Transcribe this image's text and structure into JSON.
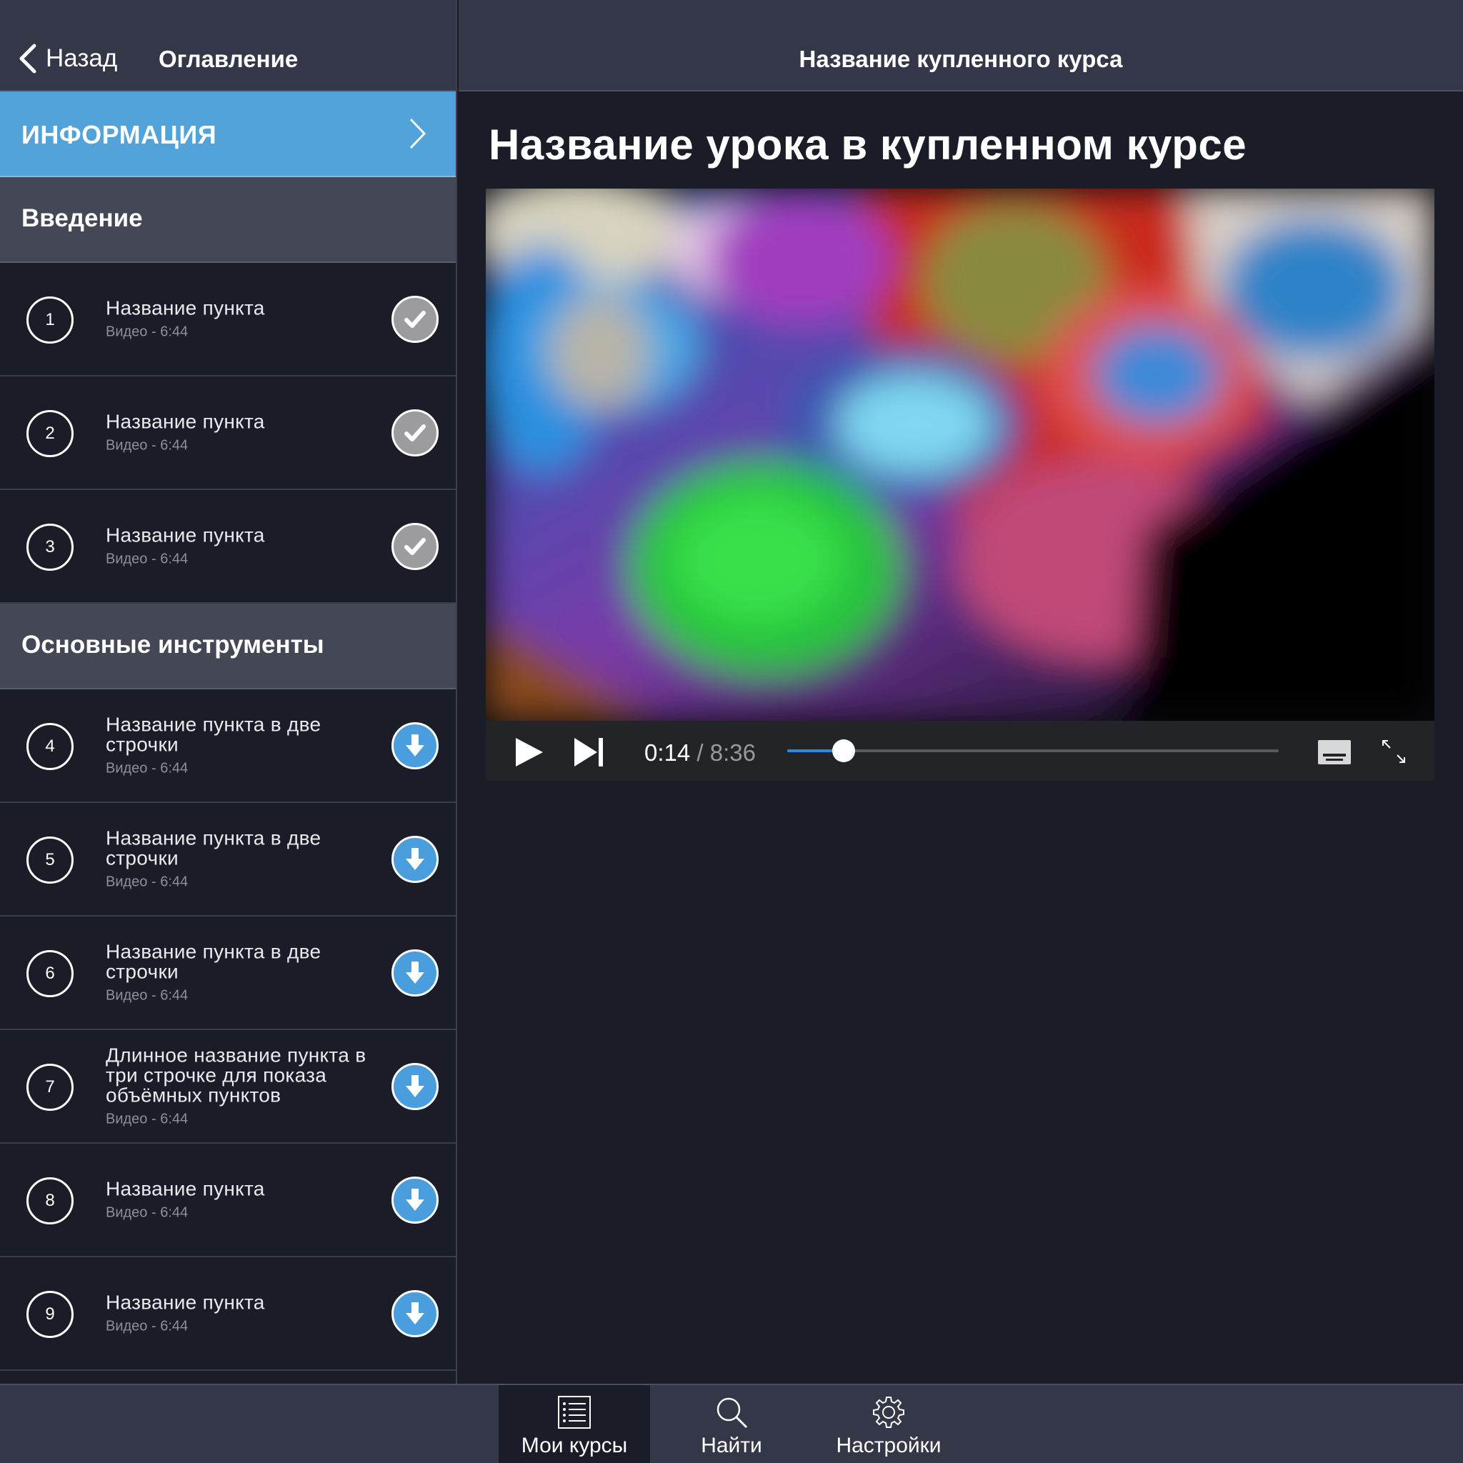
{
  "sidebar": {
    "back_label": "Назад",
    "title": "Оглавление",
    "info_label": "ИНФОРМАЦИЯ",
    "sections": [
      {
        "title": "Введение",
        "lessons": [
          {
            "num": "1",
            "title": "Название пункта",
            "sub": "Видео - 6:44",
            "status": "done"
          },
          {
            "num": "2",
            "title": "Название пункта",
            "sub": "Видео - 6:44",
            "status": "done"
          },
          {
            "num": "3",
            "title": "Название пункта",
            "sub": "Видео - 6:44",
            "status": "done"
          }
        ]
      },
      {
        "title": "Основные инструменты",
        "lessons": [
          {
            "num": "4",
            "title": "Название пункта в две строчки",
            "sub": "Видео - 6:44",
            "status": "download"
          },
          {
            "num": "5",
            "title": "Название пункта в две строчки",
            "sub": "Видео - 6:44",
            "status": "download"
          },
          {
            "num": "6",
            "title": "Название пункта в две строчки",
            "sub": "Видео - 6:44",
            "status": "download"
          },
          {
            "num": "7",
            "title": "Длинное название пункта в три строчке для показа объёмных пунктов",
            "sub": "Видео - 6:44",
            "status": "download"
          },
          {
            "num": "8",
            "title": "Название пункта",
            "sub": "Видео - 6:44",
            "status": "download"
          },
          {
            "num": "9",
            "title": "Название пункта",
            "sub": "Видео - 6:44",
            "status": "download"
          }
        ]
      }
    ]
  },
  "main": {
    "course_title": "Название купленного курса",
    "lesson_title": "Название урока в купленном курсе"
  },
  "player": {
    "current_time": "0:14",
    "separator": "/",
    "total_time": "8:36",
    "progress": 0.115,
    "icons": [
      "play-icon",
      "skip-next-icon",
      "subtitles-icon",
      "fullscreen-icon"
    ]
  },
  "tabbar": {
    "tabs": [
      {
        "label": "Мои курсы",
        "icon": "courses-list-icon",
        "active": true
      },
      {
        "label": "Найти",
        "icon": "search-icon",
        "active": false
      },
      {
        "label": "Настройки",
        "icon": "gear-icon",
        "active": false
      }
    ]
  },
  "colors": {
    "accent": "#52a3d9",
    "download": "#4a9ede",
    "done": "#9c9c9e",
    "header": "#343747",
    "background": "#1a1d27",
    "section": "#444856",
    "seek": "#2b8be0"
  }
}
